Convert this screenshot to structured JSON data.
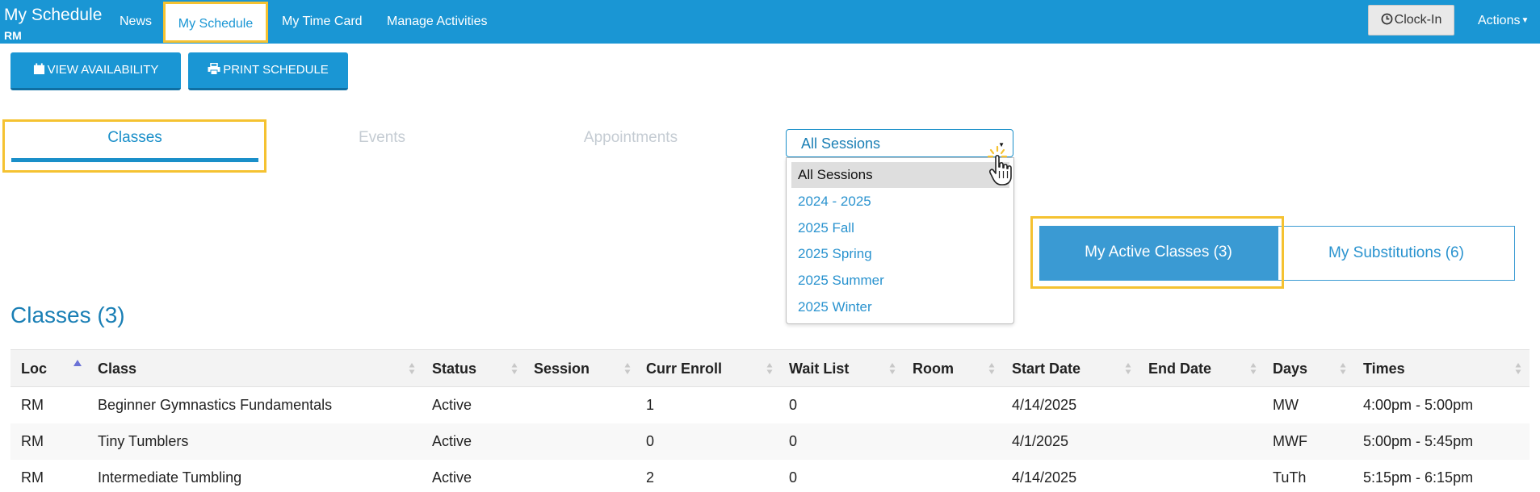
{
  "header": {
    "title": "My Schedule",
    "subtitle": "RM",
    "nav": [
      {
        "label": "News",
        "active": false
      },
      {
        "label": "My Schedule",
        "active": true
      },
      {
        "label": "My Time Card",
        "active": false
      },
      {
        "label": "Manage Activities",
        "active": false
      }
    ],
    "clock_in_label": "Clock-In",
    "actions_label": "Actions"
  },
  "toolbar": {
    "view_availability_label": "VIEW AVAILABILITY",
    "print_schedule_label": "PRINT SCHEDULE"
  },
  "tabs": [
    {
      "label": "Classes",
      "active": true
    },
    {
      "label": "Events",
      "active": false
    },
    {
      "label": "Appointments",
      "active": false
    }
  ],
  "session_select": {
    "value": "All Sessions",
    "options": [
      "All Sessions",
      "2024 - 2025",
      "2025 Fall",
      "2025 Spring",
      "2025 Summer",
      "2025 Winter"
    ]
  },
  "segments": {
    "active_classes_label": "My Active Classes (3)",
    "substitutions_label": "My Substitutions (6)"
  },
  "classes": {
    "title": "Classes (3)",
    "columns": [
      "Loc",
      "Class",
      "Status",
      "Session",
      "Curr Enroll",
      "Wait List",
      "Room",
      "Start Date",
      "End Date",
      "Days",
      "Times"
    ],
    "rows": [
      [
        "RM",
        "Beginner Gymnastics Fundamentals",
        "Active",
        "",
        "1",
        "0",
        "",
        "4/14/2025",
        "",
        "MW",
        "4:00pm - 5:00pm"
      ],
      [
        "RM",
        "Tiny Tumblers",
        "Active",
        "",
        "0",
        "0",
        "",
        "4/1/2025",
        "",
        "MWF",
        "5:00pm - 5:45pm"
      ],
      [
        "RM",
        "Intermediate Tumbling",
        "Active",
        "",
        "2",
        "0",
        "",
        "4/14/2025",
        "",
        "TuTh",
        "5:15pm - 6:15pm"
      ]
    ]
  },
  "colors": {
    "brand": "#1a96d4",
    "highlight": "#f5c231",
    "link": "#2a93cf"
  }
}
